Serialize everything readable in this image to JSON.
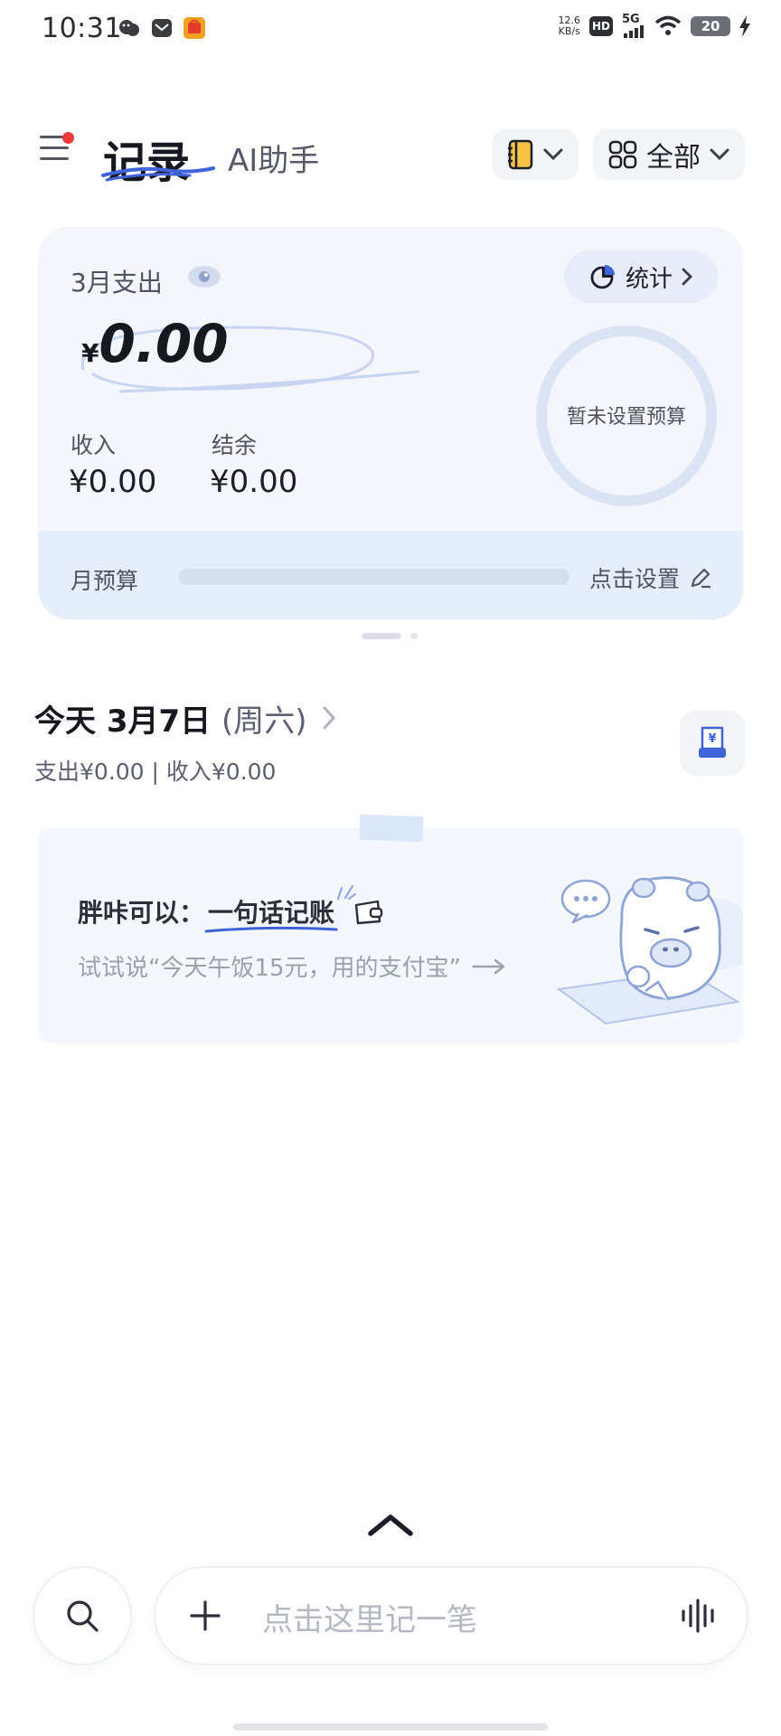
{
  "status_bar": {
    "time": "10:31",
    "net_speed": "12.6",
    "net_unit": "KB/s",
    "hd": "HD",
    "signal": "5G",
    "battery": "20"
  },
  "header": {
    "tab_active": "记录",
    "tab_ai": "AI助手",
    "filter_label": "全部"
  },
  "summary": {
    "month_label": "3月支出",
    "currency": "¥",
    "expense": "0.00",
    "stats_label": "统计",
    "income_label": "收入",
    "income_value": "¥0.00",
    "balance_label": "结余",
    "balance_value": "¥0.00",
    "budget_ring_text": "暂未设置预算",
    "monthly_budget_label": "月预算",
    "set_label": "点击设置",
    "budget_progress": 0
  },
  "day": {
    "title": "今天 3月7日",
    "weekday": "(周六)",
    "summary": "支出¥0.00 | 收入¥0.00"
  },
  "promo": {
    "title_prefix": "胖咔可以：",
    "title_highlight": "一句话记账",
    "subtitle": "试试说“今天午饭15元，用的支付宝”"
  },
  "bottom": {
    "input_placeholder": "点击这里记一笔"
  },
  "colors": {
    "accent_blue": "#3f63d8",
    "card_bg": "#f4f6fb",
    "budget_band": "#e6edfb"
  }
}
